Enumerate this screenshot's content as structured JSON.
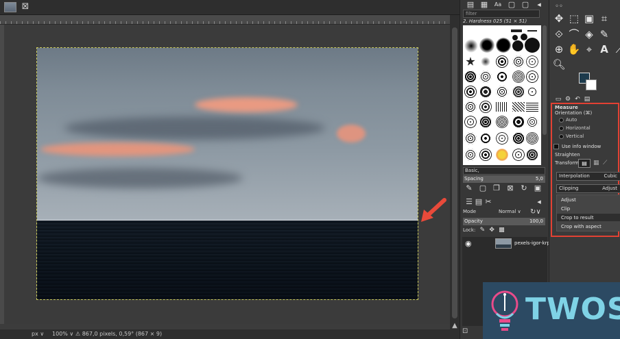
{
  "canvas": {
    "status": {
      "unit": "px ∨",
      "zoom": "100% ∨",
      "measure_text": "⚠ 867,0 pixels, 0,59° (867 × 9)"
    }
  },
  "dock_mid": {
    "filter_placeholder": "filter",
    "brush_name": "2. Hardness 025 (51 × 51)",
    "brush_set": "Basic,",
    "spacing_label": "Spacing",
    "spacing_value": "5,0",
    "mode_label": "Mode",
    "mode_value": "Normal ∨",
    "opacity_label": "Opacity",
    "opacity_value": "100,0",
    "lock_label": "Lock:",
    "layer_name": "pexels-igor-krpc"
  },
  "tool_options": {
    "title": "Measure",
    "orientation_label": "Orientation (⌘)",
    "orientation_options": [
      "Auto",
      "Horizontal",
      "Vertical"
    ],
    "info_window_label": "Use info window",
    "straighten_label": "Straighten",
    "transform_label": "Transform",
    "interpolation_label": "Interpolation",
    "interpolation_value": "Cubic",
    "clipping_label": "Clipping",
    "clipping_value": "Adjust",
    "clipping_options": [
      "Adjust",
      "Clip",
      "Crop to result",
      "Crop with aspect"
    ],
    "clipping_highlighted": "Crop to result"
  },
  "colors": {
    "foreground": "#1c3a4c",
    "background": "#ffffff",
    "highlight_border": "#e34133",
    "arrow": "#e84a3a"
  },
  "logo": {
    "text": "TWOS"
  }
}
